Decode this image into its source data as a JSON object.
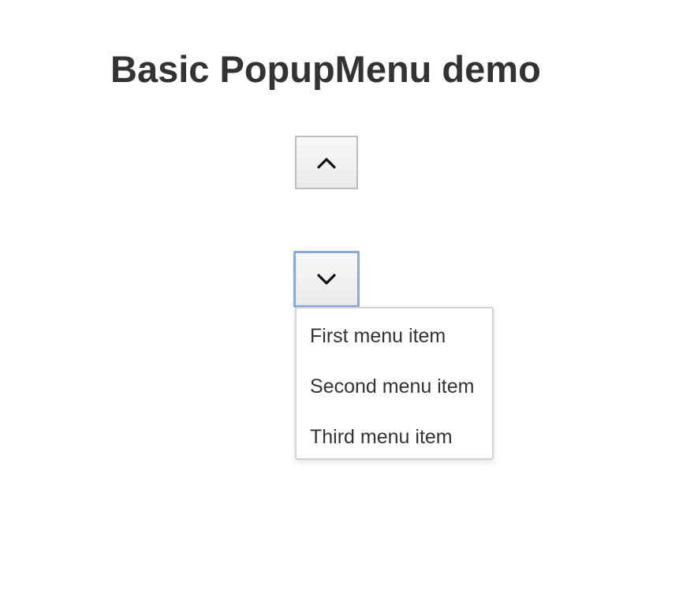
{
  "page": {
    "title": "Basic PopupMenu demo"
  },
  "buttons": {
    "up": {
      "icon": "chevron-up-icon"
    },
    "down": {
      "icon": "chevron-down-icon",
      "state": "focused"
    }
  },
  "menu": {
    "items": [
      {
        "label": "First menu item"
      },
      {
        "label": "Second menu item"
      },
      {
        "label": "Third menu item"
      }
    ]
  },
  "colors": {
    "text": "#333333",
    "button_border": "#bdbdbd",
    "focus_border": "#85a8e6",
    "menu_border": "#d2d2d2"
  }
}
